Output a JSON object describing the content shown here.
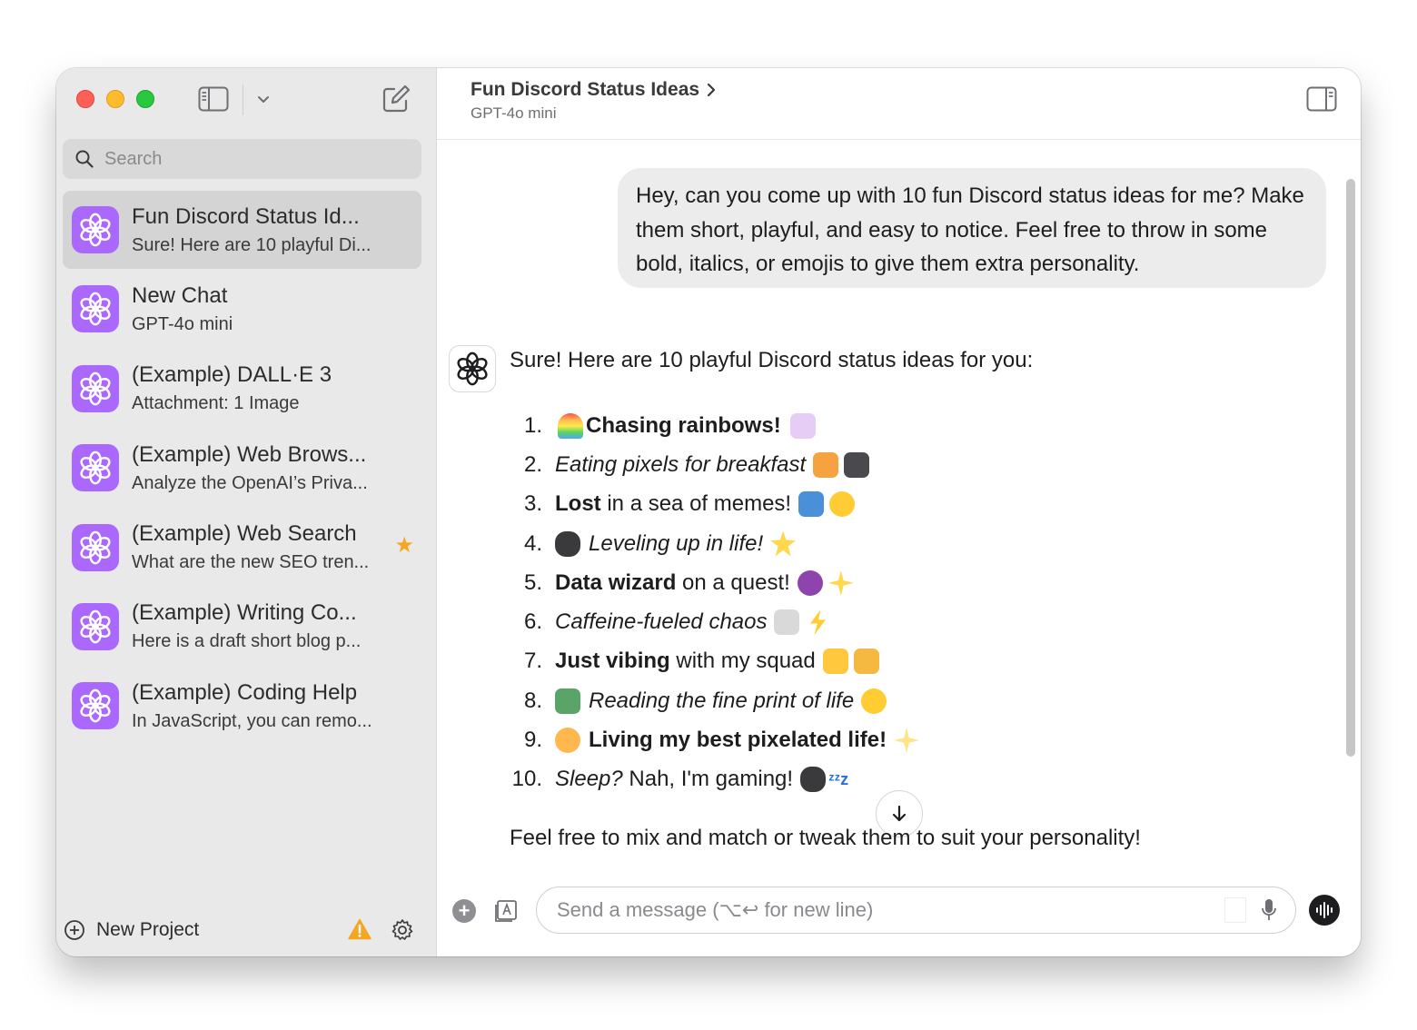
{
  "sidebar": {
    "search_placeholder": "Search",
    "chats": [
      {
        "title": "Fun Discord Status Id...",
        "subtitle": "Sure! Here are 10 playful Di..."
      },
      {
        "title": "New Chat",
        "subtitle": "GPT-4o mini"
      },
      {
        "title": "(Example) DALL·E 3",
        "subtitle": "Attachment: 1 Image"
      },
      {
        "title": "(Example) Web Brows...",
        "subtitle": "Analyze the OpenAI’s Priva..."
      },
      {
        "title": "(Example) Web Search",
        "subtitle": "What are the new SEO tren..."
      },
      {
        "title": "(Example) Writing Co...",
        "subtitle": "Here is a draft short blog p..."
      },
      {
        "title": "(Example) Coding Help",
        "subtitle": "In JavaScript, you can remo..."
      }
    ],
    "new_project_label": "New Project"
  },
  "header": {
    "title": "Fun Discord Status Ideas",
    "model": "GPT-4o mini"
  },
  "conversation": {
    "user_message": "Hey, can you come up with 10 fun Discord status ideas for me? Make them short, playful, and easy to notice. Feel free to throw in some bold, italics, or emojis to give them extra personality.",
    "assistant_intro": "Sure! Here are 10 playful Discord status ideas for you:",
    "items": [
      {
        "num": "1.",
        "text": "Chasing rainbows!"
      },
      {
        "num": "2.",
        "text": "Eating pixels for breakfast"
      },
      {
        "num": "3.",
        "bold": "Lost",
        "rest": " in a sea of memes!"
      },
      {
        "num": "4.",
        "text": "Leveling up in life!"
      },
      {
        "num": "5.",
        "bold": "Data wizard",
        "rest": " on a quest!"
      },
      {
        "num": "6.",
        "text": "Caffeine-fueled chaos"
      },
      {
        "num": "7.",
        "bold": "Just vibing",
        "rest": " with my squad"
      },
      {
        "num": "8.",
        "text": "Reading the fine print of life"
      },
      {
        "num": "9.",
        "text": "Living my best pixelated life!"
      },
      {
        "num": "10.",
        "italic": "Sleep?",
        "rest": " Nah, I'm gaming!"
      }
    ],
    "assistant_outro": "Feel free to mix and match or tweak them to suit your personality!"
  },
  "composer": {
    "placeholder": "Send a message (⌥↩ for new line)"
  },
  "colors": {
    "avatar_purple": "#ab68ff",
    "star": "#f5a623",
    "warning": "#f5a623"
  }
}
